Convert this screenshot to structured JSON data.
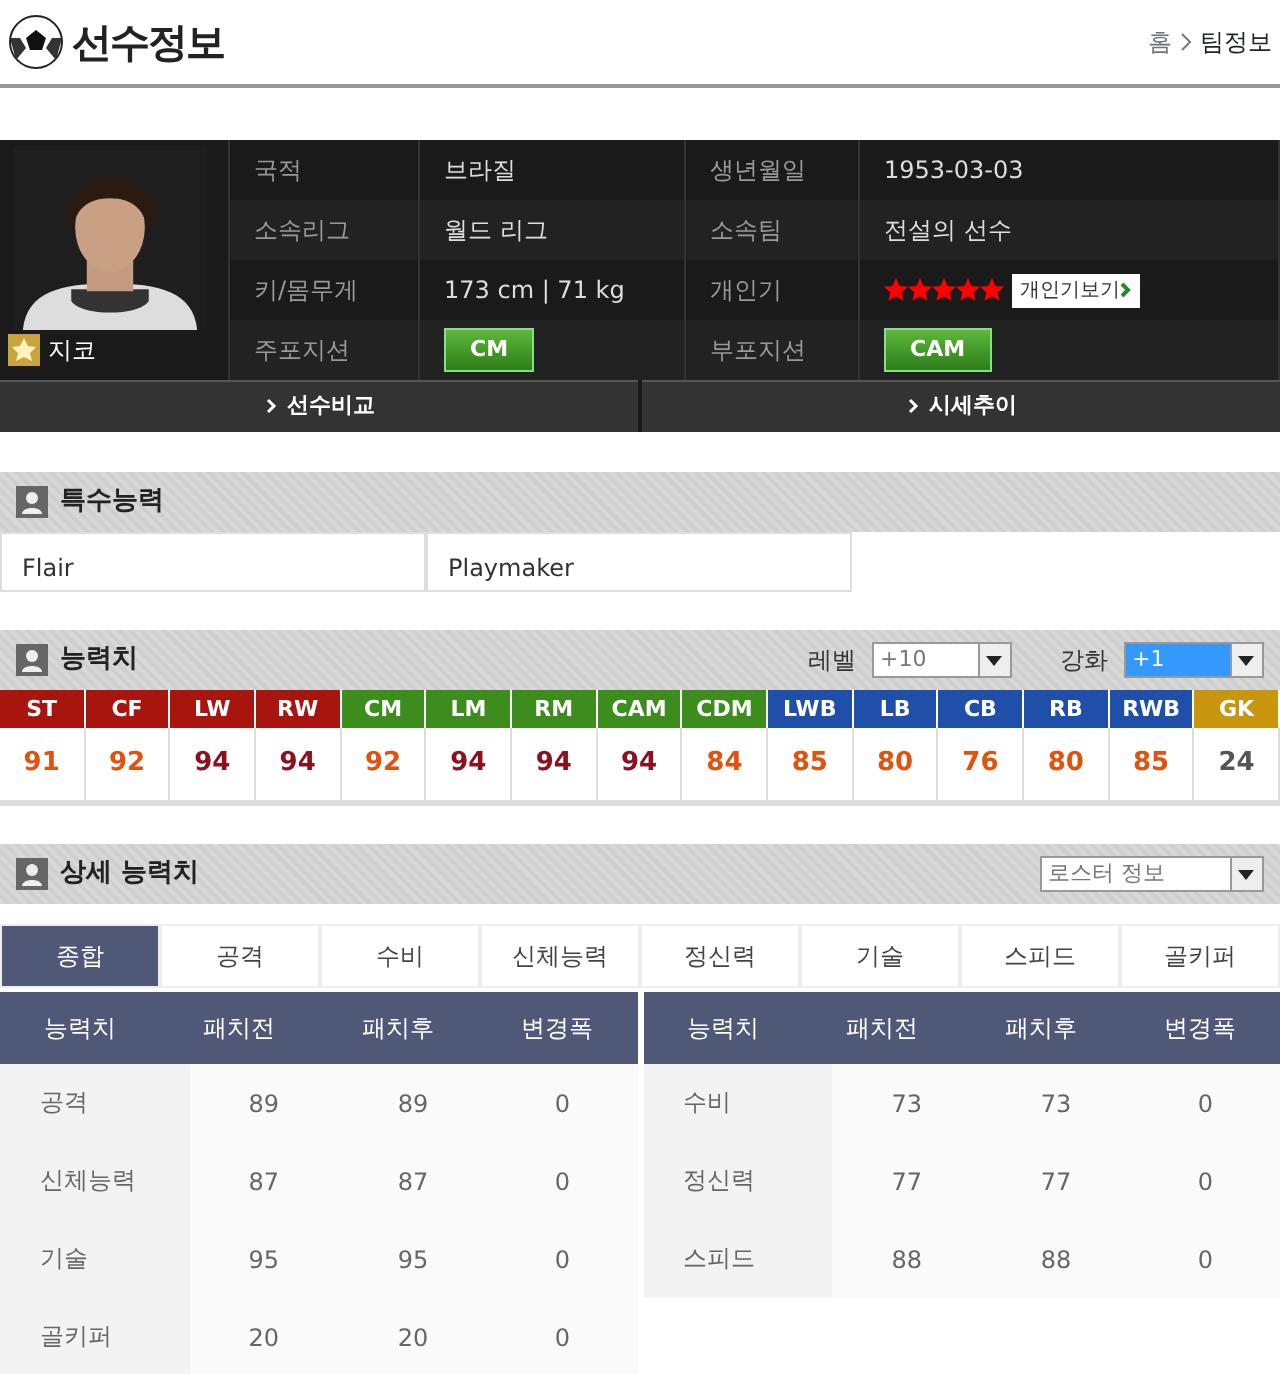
{
  "header": {
    "title": "선수정보",
    "breadcrumb": [
      "홈",
      "팀정보"
    ]
  },
  "player": {
    "name": "지코",
    "info": [
      {
        "label": "국적",
        "value": "브라질",
        "kind": "text"
      },
      {
        "label": "생년월일",
        "value": "1953-03-03",
        "kind": "text"
      },
      {
        "label": "소속리그",
        "value": "월드 리그",
        "kind": "text"
      },
      {
        "label": "소속팀",
        "value": "전설의 선수",
        "kind": "text"
      },
      {
        "label": "키/몸무게",
        "value": "173 cm | 71 kg",
        "kind": "text"
      },
      {
        "label": "개인기",
        "stars": 5,
        "button": "개인기보기",
        "kind": "stars"
      },
      {
        "label": "주포지션",
        "value": "CM",
        "kind": "badge"
      },
      {
        "label": "부포지션",
        "value": "CAM",
        "kind": "badge"
      }
    ],
    "buttons": [
      "선수비교",
      "시세추이"
    ]
  },
  "special": {
    "title": "특수능력",
    "traits": [
      "Flair",
      "Playmaker"
    ]
  },
  "stats": {
    "title": "능력치",
    "level_label": "레벨",
    "level_value": "+10",
    "level_highlighted": false,
    "enhance_label": "강화",
    "enhance_value": "+1",
    "enhance_highlighted": true,
    "positions": [
      {
        "name": "ST",
        "color": "#a8140e",
        "rating": {
          "value": "91",
          "color": "#e0520e"
        }
      },
      {
        "name": "CF",
        "color": "#a8140e",
        "rating": {
          "value": "92",
          "color": "#e0520e"
        }
      },
      {
        "name": "LW",
        "color": "#a8140e",
        "rating": {
          "value": "94",
          "color": "#8c1020"
        }
      },
      {
        "name": "RW",
        "color": "#a8140e",
        "rating": {
          "value": "94",
          "color": "#8c1020"
        }
      },
      {
        "name": "CM",
        "color": "#3c8c1e",
        "rating": {
          "value": "92",
          "color": "#e0520e"
        }
      },
      {
        "name": "LM",
        "color": "#3c8c1e",
        "rating": {
          "value": "94",
          "color": "#8c1020"
        }
      },
      {
        "name": "RM",
        "color": "#3c8c1e",
        "rating": {
          "value": "94",
          "color": "#8c1020"
        }
      },
      {
        "name": "CAM",
        "color": "#3c8c1e",
        "rating": {
          "value": "94",
          "color": "#8c1020"
        }
      },
      {
        "name": "CDM",
        "color": "#3c8c1e",
        "rating": {
          "value": "84",
          "color": "#e0520e"
        }
      },
      {
        "name": "LWB",
        "color": "#1f4fa8",
        "rating": {
          "value": "85",
          "color": "#e0520e"
        }
      },
      {
        "name": "LB",
        "color": "#1f4fa8",
        "rating": {
          "value": "80",
          "color": "#e0520e"
        }
      },
      {
        "name": "CB",
        "color": "#1f4fa8",
        "rating": {
          "value": "76",
          "color": "#e0520e"
        }
      },
      {
        "name": "RB",
        "color": "#1f4fa8",
        "rating": {
          "value": "80",
          "color": "#e0520e"
        }
      },
      {
        "name": "RWB",
        "color": "#1f4fa8",
        "rating": {
          "value": "85",
          "color": "#e0520e"
        }
      },
      {
        "name": "GK",
        "color": "#c8960e",
        "rating": {
          "value": "24",
          "color": "#555555"
        }
      }
    ]
  },
  "detail": {
    "title": "상세 능력치",
    "dropdown": "로스터 정보",
    "tabs": [
      {
        "label": "종합",
        "selected": true
      },
      {
        "label": "공격",
        "selected": false
      },
      {
        "label": "수비",
        "selected": false
      },
      {
        "label": "신체능력",
        "selected": false
      },
      {
        "label": "정신력",
        "selected": false
      },
      {
        "label": "기술",
        "selected": false
      },
      {
        "label": "스피드",
        "selected": false
      },
      {
        "label": "골키퍼",
        "selected": false
      }
    ],
    "left_columns": [
      "능력치",
      "패치전",
      "패치후",
      "변경폭"
    ],
    "right_columns": [
      "능력치",
      "패치전",
      "패치후",
      "변경폭"
    ],
    "left_rows": [
      [
        "공격",
        "89",
        "89",
        "0"
      ],
      [
        "신체능력",
        "87",
        "87",
        "0"
      ],
      [
        "기술",
        "95",
        "95",
        "0"
      ],
      [
        "골키퍼",
        "20",
        "20",
        "0"
      ]
    ],
    "right_rows": [
      [
        "수비",
        "73",
        "73",
        "0"
      ],
      [
        "정신력",
        "77",
        "77",
        "0"
      ],
      [
        "스피드",
        "88",
        "88",
        "0"
      ]
    ]
  }
}
